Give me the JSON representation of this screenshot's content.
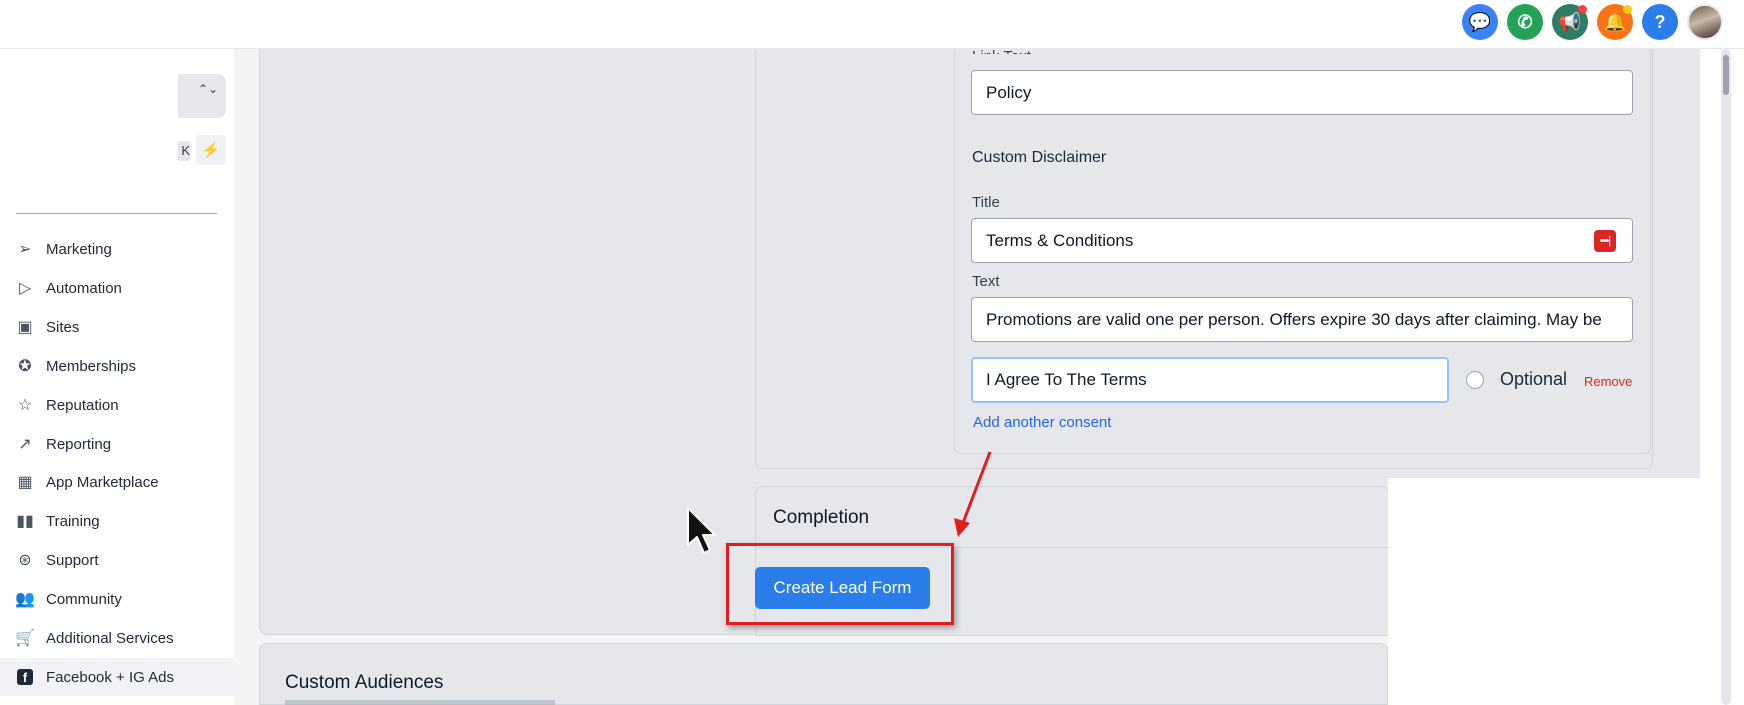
{
  "topbar": {
    "icons": [
      {
        "name": "chat-icon",
        "glyph": "💬",
        "color": "#3b82f6"
      },
      {
        "name": "phone-icon",
        "glyph": "✆",
        "color": "#22a355"
      },
      {
        "name": "megaphone-icon",
        "glyph": "📢",
        "color": "#2f7d64",
        "badge": "#ef4444"
      },
      {
        "name": "bell-icon",
        "glyph": "🔔",
        "color": "#f97316",
        "badge": "#facc15"
      },
      {
        "name": "help-icon",
        "glyph": "?",
        "color": "#2b7de9"
      }
    ]
  },
  "sidebar": {
    "switcher_chevrons": "⌃⌄",
    "shortcut_key": "K",
    "bolt_glyph": "⚡",
    "items": [
      {
        "label": "Marketing",
        "icon": "send-icon",
        "glyph": "➢"
      },
      {
        "label": "Automation",
        "icon": "play-circle-icon",
        "glyph": "▷"
      },
      {
        "label": "Sites",
        "icon": "globe-window-icon",
        "glyph": "▣"
      },
      {
        "label": "Memberships",
        "icon": "badge-icon",
        "glyph": "✪"
      },
      {
        "label": "Reputation",
        "icon": "star-icon",
        "glyph": "☆"
      },
      {
        "label": "Reporting",
        "icon": "trend-icon",
        "glyph": "↗"
      },
      {
        "label": "App Marketplace",
        "icon": "grid-icon",
        "glyph": "▦"
      },
      {
        "label": "Training",
        "icon": "book-icon",
        "glyph": "▮▮"
      },
      {
        "label": "Support",
        "icon": "lifebuoy-icon",
        "glyph": "⊛"
      },
      {
        "label": "Community",
        "icon": "users-icon",
        "glyph": "👥"
      },
      {
        "label": "Additional Services",
        "icon": "cart-icon",
        "glyph": "🛒"
      },
      {
        "label": "Facebook + IG Ads",
        "icon": "facebook-icon",
        "glyph": "f"
      }
    ]
  },
  "form": {
    "link_text_label": "Link Text",
    "link_text_value": "Policy",
    "custom_disclaimer_heading": "Custom Disclaimer",
    "title_label": "Title",
    "title_value": "Terms & Conditions",
    "text_label": "Text",
    "text_value": "Promotions are valid one per person. Offers expire 30 days after claiming. May be",
    "consent_value": "I Agree To The Terms",
    "optional_label": "Optional",
    "remove_label": "Remove",
    "add_consent_label": "Add another consent",
    "password_manager_glyph": "•••|"
  },
  "completion": {
    "title": "Completion",
    "create_button": "Create Lead Form"
  },
  "custom_audiences": {
    "title": "Custom Audiences"
  },
  "colors": {
    "primary": "#2b7de9",
    "annotation_red": "#e11d1d",
    "remove_red": "#dc2626",
    "link_blue": "#2563eb"
  }
}
